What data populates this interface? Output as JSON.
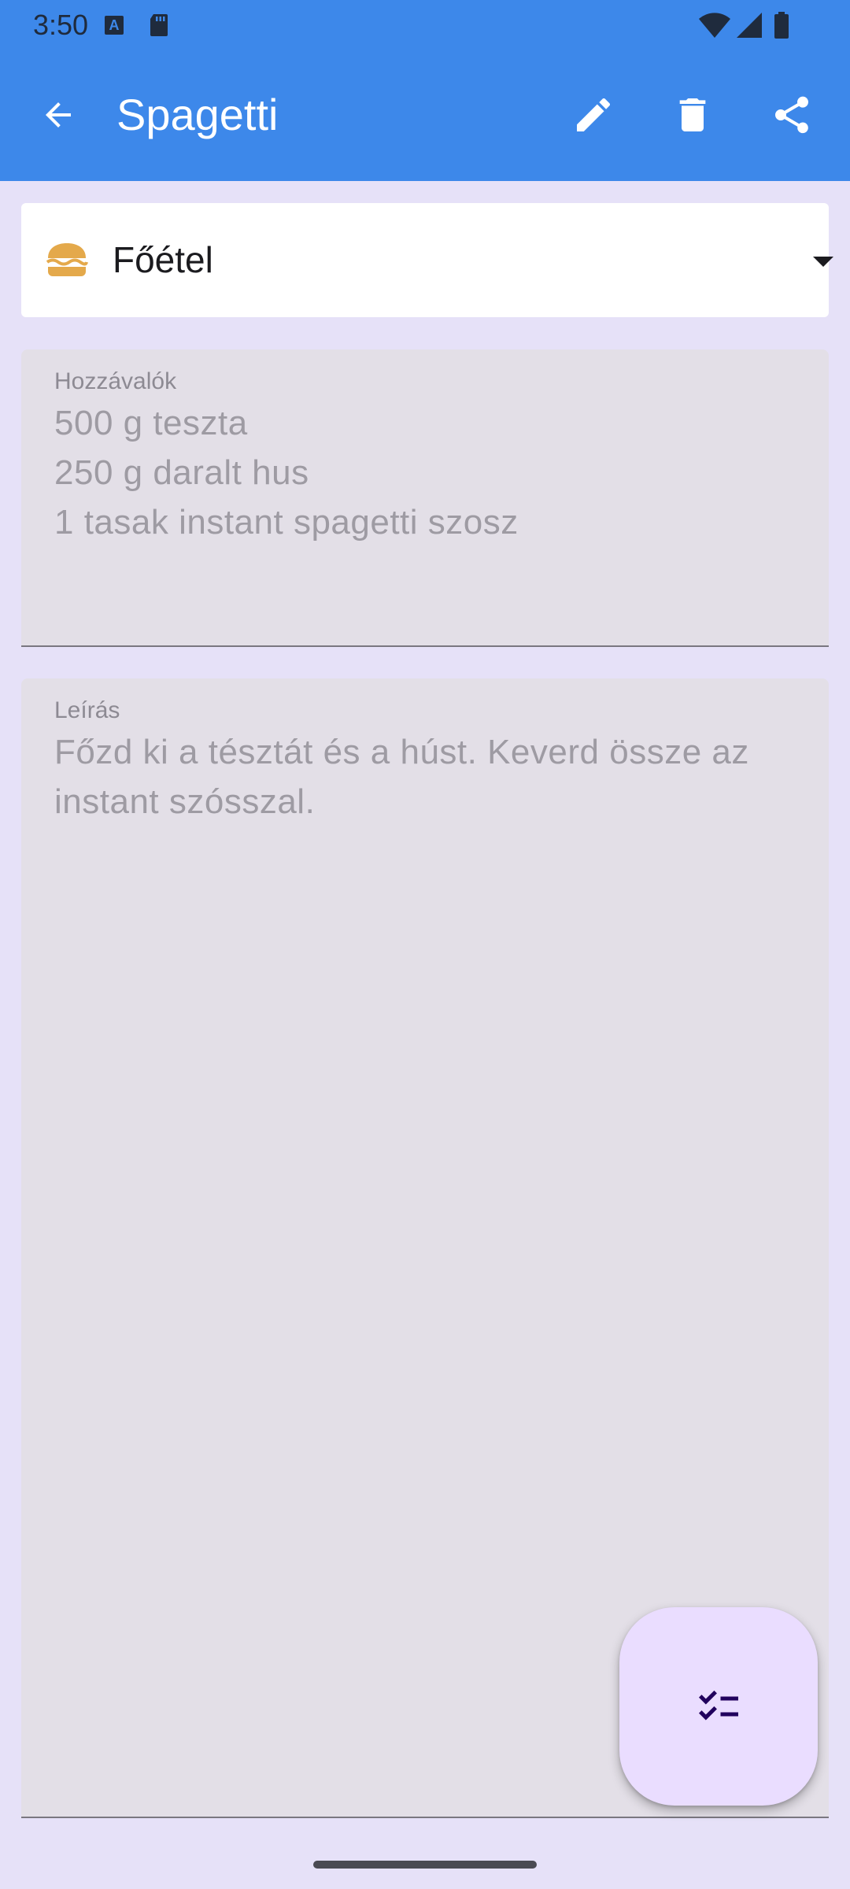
{
  "status_bar": {
    "time": "3:50",
    "icons": [
      "keyboard-a-icon",
      "sd-card-icon",
      "wifi-icon",
      "signal-icon",
      "battery-icon"
    ]
  },
  "app_bar": {
    "title": "Spagetti",
    "actions": [
      "edit-icon",
      "delete-icon",
      "share-icon"
    ]
  },
  "category": {
    "icon": "burger-icon",
    "selected": "Főétel"
  },
  "ingredients": {
    "label": "Hozzávalók",
    "value": "500 g teszta\n250 g daralt hus\n1 tasak instant spagetti szosz"
  },
  "description": {
    "label": "Leírás",
    "value": "Főzd ki a tésztát és a húst. Keverd össze az instant szósszal."
  },
  "fab": {
    "icon": "checklist-icon"
  },
  "colors": {
    "app_bar": "#3D88EA",
    "background": "#E6E1F8",
    "field": "#E3DFE7",
    "fab": "#EADDFF"
  }
}
